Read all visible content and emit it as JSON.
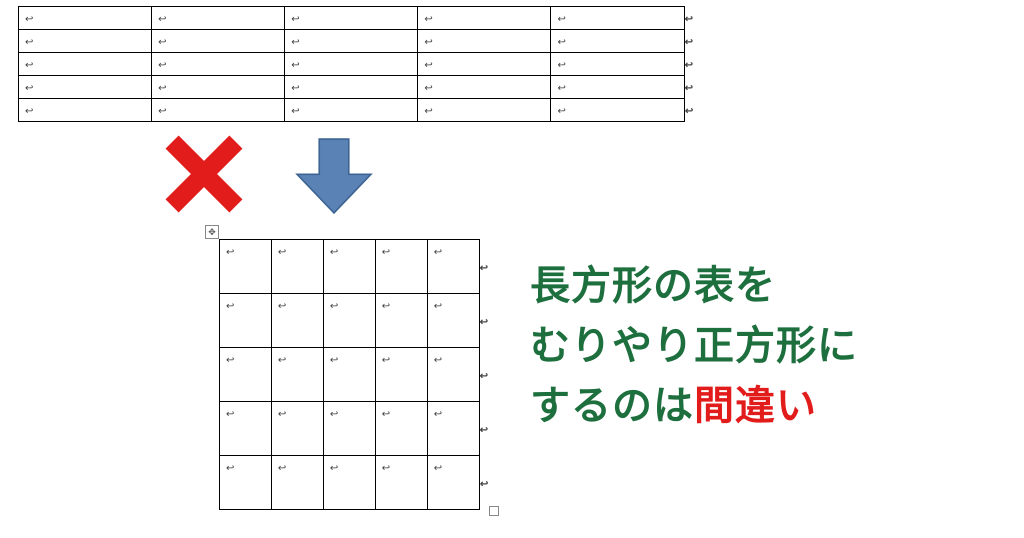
{
  "glyphs": {
    "paragraph_mark": "↩",
    "move_handle": "✥"
  },
  "colors": {
    "text_green": "#1e6f3e",
    "text_red": "#e21b1b",
    "arrow_fill": "#5b82b4",
    "arrow_stroke": "#3d6493",
    "x_mark": "#e21b1b"
  },
  "tables": {
    "rectangular": {
      "rows": 5,
      "cols": 5
    },
    "square": {
      "rows": 5,
      "cols": 5
    }
  },
  "caption": {
    "line1": "長方形の表を",
    "line2": "むりやり正方形に",
    "line3_prefix": "するのは",
    "line3_highlight": "間違い"
  }
}
